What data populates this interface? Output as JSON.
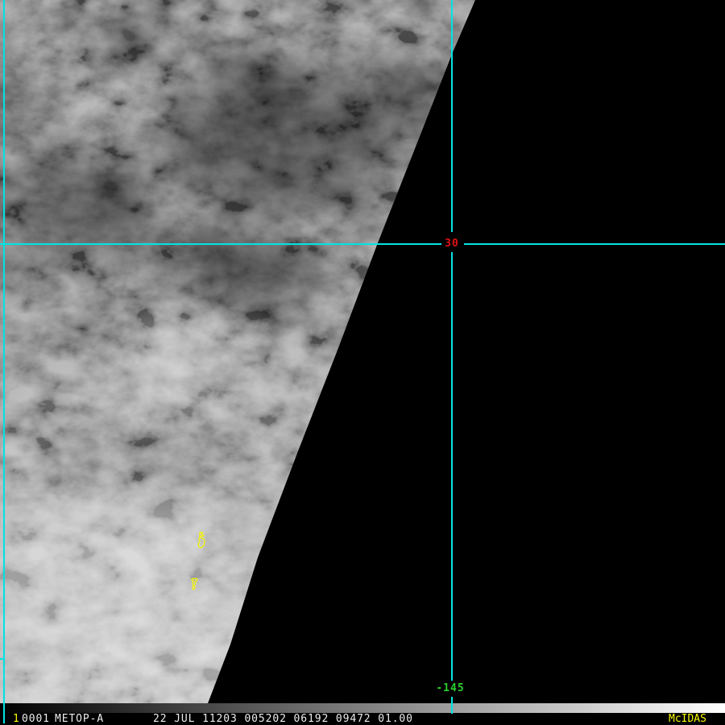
{
  "colors": {
    "background": "#000000",
    "graticule_cyan": "#00e4e4",
    "latitude_label_red": "#e01212",
    "longitude_label_green": "#2ed02e",
    "overlay_yellow": "#f8f800",
    "status_text_white": "#ededed"
  },
  "graticule": {
    "latitude_label": "30",
    "longitude_label": "-145"
  },
  "status_bar": {
    "frame_number": "1",
    "image_number": "0001",
    "satellite": "METOP-A",
    "datetime_info": "22 JUL 11203 005202 06192 09472 01.00",
    "brand": "McIDAS"
  }
}
